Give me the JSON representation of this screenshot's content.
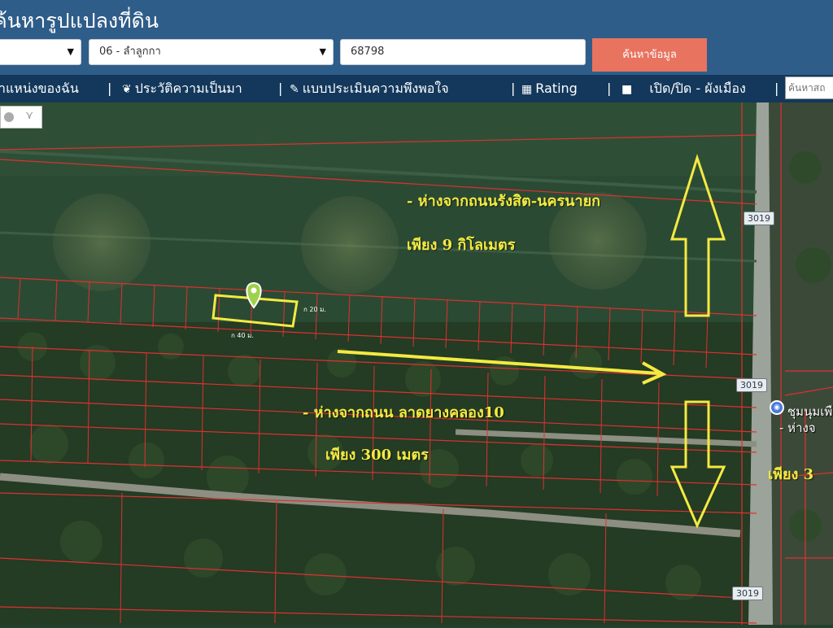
{
  "header": {
    "title": "ค้นหารูปแปลงที่ดิน",
    "province_select": {
      "value": ""
    },
    "district_select": {
      "value": "06 - ลำลูกกา"
    },
    "parcel_input": {
      "value": "68798"
    },
    "search_button": "ค้นหาข้อมูล"
  },
  "nav": {
    "items": [
      {
        "icon": "location-icon",
        "label": "าแหน่งของฉัน"
      },
      {
        "icon": "history-icon",
        "label": "ประวัติความเป็นมา"
      },
      {
        "icon": "survey-icon",
        "label": "แบบประเมินความพึงพอใจ"
      },
      {
        "icon": "rating-chart-icon",
        "label": "Rating"
      },
      {
        "icon": "toggle-square-icon",
        "label": "เปิด/ปิด - ผังเมือง"
      }
    ],
    "separator": "|",
    "search_placeholder": "ค้นหาสถ"
  },
  "map": {
    "annotations": {
      "line1": "- ห่างจากถนนรังสิต-นครนายก",
      "line2": "เพียง 9 กิโลเมตร",
      "line3": "- ห่างจากถนน ลาดยางคลอง10",
      "line4": "เพียง 300 เมตร",
      "line5": "เพียง 3"
    },
    "road_labels": [
      "3019",
      "3019",
      "3019"
    ],
    "parcel_dims": {
      "width_label": "ก 20 ม.",
      "length_label": "ก 40 ม."
    },
    "poi": {
      "name": "ชุมนุมเพื",
      "note": "- ห่างจ"
    },
    "colors": {
      "annotation": "#f4ea41",
      "parcel_boundaries": "#e03030",
      "selected_parcel": "#f4ea41",
      "marker": "#9fd14b"
    },
    "toolbar": {
      "icons": [
        "circle-tool-icon",
        "bird-icon"
      ]
    }
  }
}
